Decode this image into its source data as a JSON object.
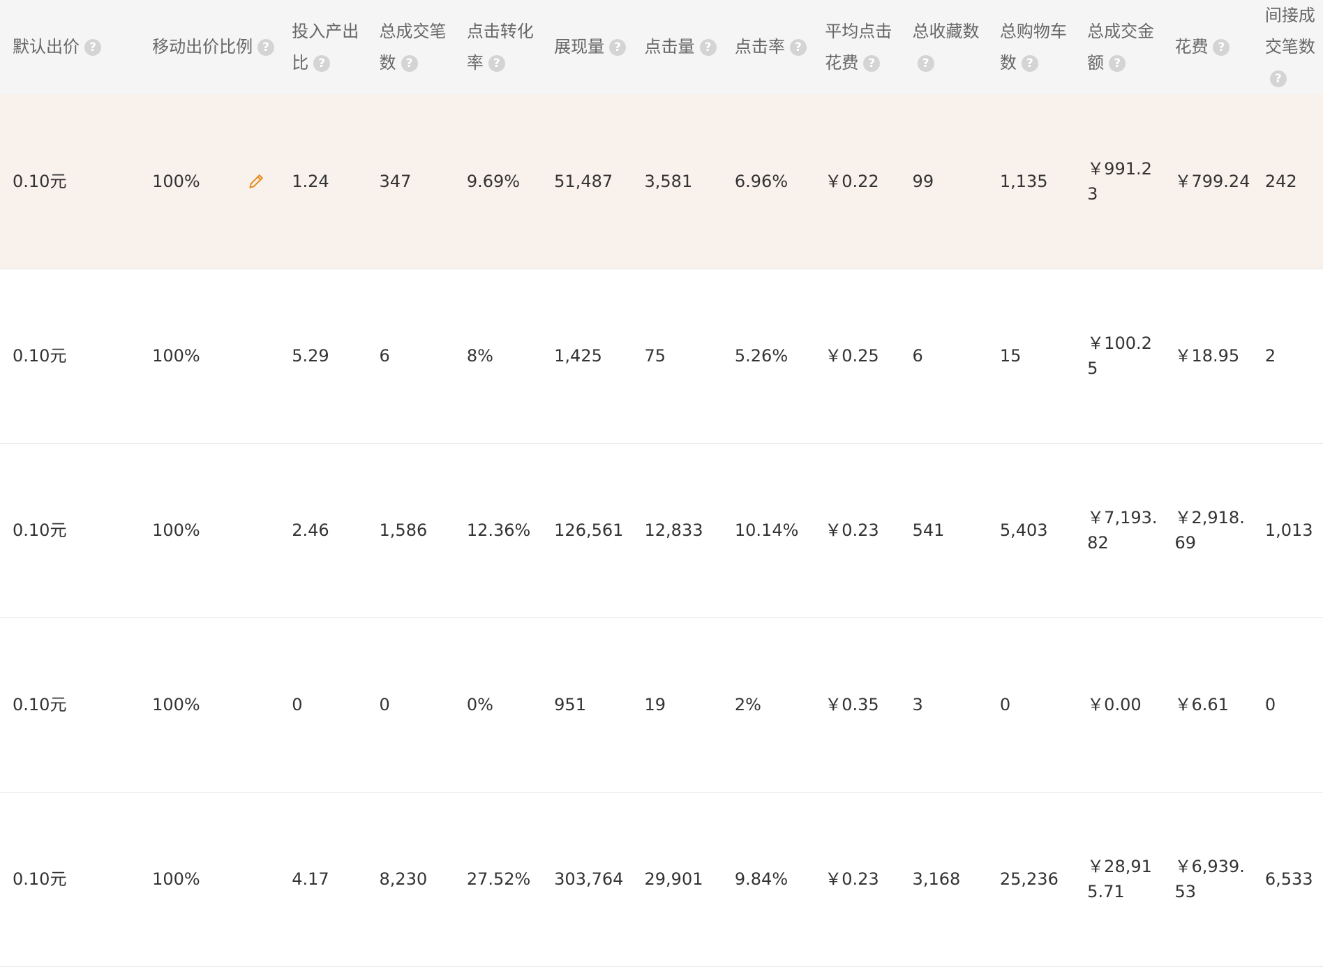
{
  "columns": [
    {
      "label": "默认出价",
      "help": true
    },
    {
      "label": "移动出价比例",
      "help": true
    },
    {
      "label": "投入产出比",
      "help": true
    },
    {
      "label": "总成交笔数",
      "help": true
    },
    {
      "label": "点击转化率",
      "help": true
    },
    {
      "label": "展现量",
      "help": true
    },
    {
      "label": "点击量",
      "help": true
    },
    {
      "label": "点击率",
      "help": true
    },
    {
      "label": "平均点击花费",
      "help": true
    },
    {
      "label": "总收藏数",
      "help": true
    },
    {
      "label": "总购物车数",
      "help": true
    },
    {
      "label": "总成交金额",
      "help": true
    },
    {
      "label": "花费",
      "help": true
    },
    {
      "label": "间接成交笔数",
      "help": true
    }
  ],
  "help_glyph": "?",
  "accent_color": "#e8891a",
  "highlight_row_color": "#f9f1ec",
  "rows": [
    {
      "highlighted": true,
      "editable": true,
      "cells": [
        "0.10元",
        "100%",
        "1.24",
        "347",
        "9.69%",
        "51,487",
        "3,581",
        "6.96%",
        "￥0.22",
        "99",
        "1,135",
        "￥991.23",
        "￥799.24",
        "242"
      ]
    },
    {
      "highlighted": false,
      "editable": false,
      "cells": [
        "0.10元",
        "100%",
        "5.29",
        "6",
        "8%",
        "1,425",
        "75",
        "5.26%",
        "￥0.25",
        "6",
        "15",
        "￥100.25",
        "￥18.95",
        "2"
      ]
    },
    {
      "highlighted": false,
      "editable": false,
      "cells": [
        "0.10元",
        "100%",
        "2.46",
        "1,586",
        "12.36%",
        "126,561",
        "12,833",
        "10.14%",
        "￥0.23",
        "541",
        "5,403",
        "￥7,193.82",
        "￥2,918.69",
        "1,013"
      ]
    },
    {
      "highlighted": false,
      "editable": false,
      "cells": [
        "0.10元",
        "100%",
        "0",
        "0",
        "0%",
        "951",
        "19",
        "2%",
        "￥0.35",
        "3",
        "0",
        "￥0.00",
        "￥6.61",
        "0"
      ]
    },
    {
      "highlighted": false,
      "editable": false,
      "cells": [
        "0.10元",
        "100%",
        "4.17",
        "8,230",
        "27.52%",
        "303,764",
        "29,901",
        "9.84%",
        "￥0.23",
        "3,168",
        "25,236",
        "￥28,915.71",
        "￥6,939.53",
        "6,533"
      ]
    }
  ],
  "icons": {
    "help": "question-circle-icon",
    "edit": "pencil-icon"
  }
}
